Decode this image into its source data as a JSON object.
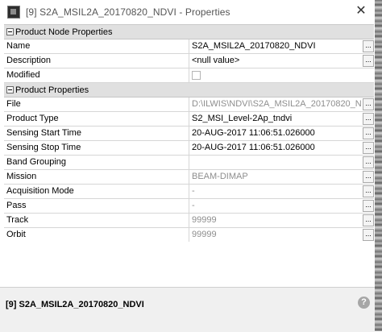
{
  "window": {
    "title": "[9] S2A_MSIL2A_20170820_NDVI - Properties",
    "close_glyph": "✕"
  },
  "sections": [
    {
      "label": "Product Node Properties",
      "rows": [
        {
          "name": "Name",
          "value": "S2A_MSIL2A_20170820_NDVI",
          "grey": false
        },
        {
          "name": "Description",
          "value": "<null value>",
          "grey": false
        },
        {
          "name": "Modified",
          "value": "",
          "checkbox": true
        }
      ]
    },
    {
      "label": "Product Properties",
      "rows": [
        {
          "name": "File",
          "value": "D:\\ILWIS\\NDVI\\S2A_MSIL2A_20170820_N...",
          "grey": true
        },
        {
          "name": "Product Type",
          "value": "S2_MSI_Level-2Ap_tndvi",
          "grey": false
        },
        {
          "name": "Sensing Start Time",
          "value": "20-AUG-2017 11:06:51.026000",
          "grey": false
        },
        {
          "name": "Sensing Stop Time",
          "value": "20-AUG-2017 11:06:51.026000",
          "grey": false
        },
        {
          "name": "Band Grouping",
          "value": "",
          "grey": false
        },
        {
          "name": "Mission",
          "value": "BEAM-DIMAP",
          "grey": true
        },
        {
          "name": "Acquisition Mode",
          "value": "-",
          "grey": true
        },
        {
          "name": "Pass",
          "value": "-",
          "grey": true
        },
        {
          "name": "Track",
          "value": "99999",
          "grey": true
        },
        {
          "name": "Orbit",
          "value": "99999",
          "grey": true
        }
      ]
    }
  ],
  "ellipsis_label": "...",
  "footer": {
    "title": "[9] S2A_MSIL2A_20170820_NDVI",
    "help_glyph": "?"
  }
}
